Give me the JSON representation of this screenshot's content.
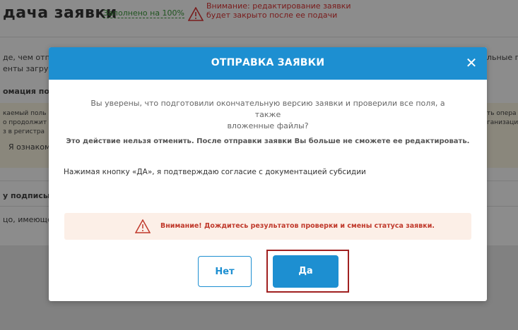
{
  "background": {
    "title": "дача заявки",
    "filled_status": "Заполнено на 100%",
    "warning_line1": "Внимание: редактирование заявки",
    "warning_line2": "будет закрыто после ее подачи",
    "left_fragments": [
      "де, чем отпр",
      "енты загру",
      "омация по",
      "каемый поль",
      "о продолжит",
      "з в регистра",
      "Я ознаком",
      "у подписы",
      "цо, имеюще"
    ],
    "right_fragments": [
      "льные п",
      "ть опера",
      "ганизаци"
    ]
  },
  "modal": {
    "title": "ОТПРАВКА ЗАЯВКИ",
    "question_line1": "Вы уверены, что подготовили окончательную версию заявки и проверили все поля, а также",
    "question_line2": "вложенные файлы?",
    "irreversible": "Это действие нельзя отменить. После отправки заявки Вы больше не сможете ее редактировать.",
    "consent": "Нажимая кнопку «ДА», я подтверждаю согласие с документацией субсидии",
    "alert": "Внимание! Дождитесь результатов проверки и смены статуса заявки.",
    "no_label": "Нет",
    "yes_label": "Да",
    "close_glyph": "✕"
  },
  "colors": {
    "accent": "#1d8fd1",
    "alert_text": "#c0392b",
    "alert_bg": "#fcefe7",
    "highlight_frame": "#a02020"
  },
  "icons": [
    "warning-triangle-icon",
    "close-icon"
  ]
}
